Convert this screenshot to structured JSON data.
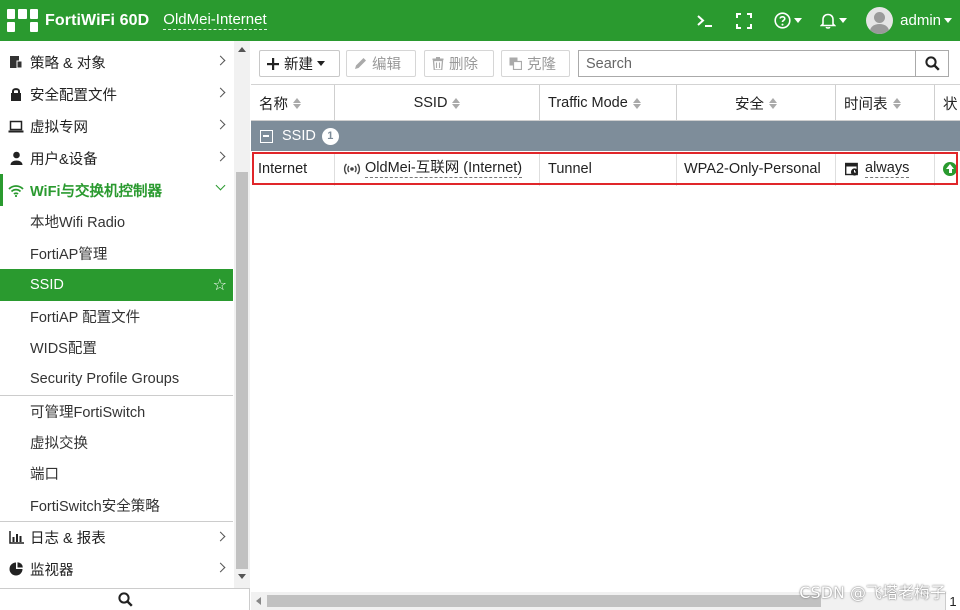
{
  "header": {
    "brand": "FortiWiFi 60D",
    "hostname": "OldMei-Internet",
    "cli_icon": "terminal-icon",
    "fullscreen_icon": "fullscreen-icon",
    "help_icon": "help-icon",
    "notification_icon": "bell-icon",
    "username": "admin",
    "accent_color": "#2a9a2f"
  },
  "sidebar": {
    "items_top": [
      {
        "label": "策略 & 对象",
        "icon": "policy-icon"
      },
      {
        "label": "安全配置文件",
        "icon": "lock-icon"
      },
      {
        "label": "虚拟专网",
        "icon": "laptop-icon"
      },
      {
        "label": "用户&设备",
        "icon": "user-icon"
      }
    ],
    "expanded": {
      "label": "WiFi与交换机控制器",
      "icon": "wifi-icon"
    },
    "sub_items": [
      "本地Wifi Radio",
      "FortiAP管理",
      "SSID",
      "FortiAP 配置文件",
      "WIDS配置",
      "Security Profile Groups",
      "可管理FortiSwitch",
      "虚拟交换",
      "端口",
      "FortiSwitch安全策略"
    ],
    "active_sub": "SSID",
    "items_bottom": [
      {
        "label": "日志 & 报表",
        "icon": "chart-icon"
      },
      {
        "label": "监视器",
        "icon": "pie-icon"
      }
    ]
  },
  "toolbar": {
    "new_label": "新建",
    "edit_label": "编辑",
    "delete_label": "删除",
    "clone_label": "克隆",
    "search_placeholder": "Search"
  },
  "table": {
    "columns": [
      "名称",
      "SSID",
      "Traffic Mode",
      "安全",
      "时间表",
      "状"
    ],
    "group": {
      "label": "SSID",
      "count": "1"
    },
    "rows": [
      {
        "name": "Internet",
        "ssid": "OldMei-互联网 (Internet)",
        "traffic_mode": "Tunnel",
        "security": "WPA2-Only-Personal",
        "schedule": "always",
        "status": "up"
      }
    ]
  },
  "pager": {
    "page": "1"
  },
  "watermark": "CSDN @飞塔老梅子"
}
